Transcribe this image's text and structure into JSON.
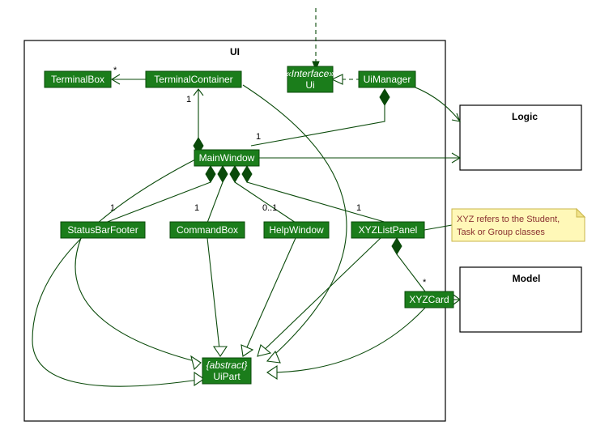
{
  "packages": {
    "ui": {
      "label": "UI"
    },
    "logic": {
      "label": "Logic"
    },
    "model": {
      "label": "Model"
    }
  },
  "nodes": {
    "terminalBox": "TerminalBox",
    "terminalContainer": "TerminalContainer",
    "uiInterface": {
      "stereotype": "«Interface»",
      "name": "Ui"
    },
    "uiManager": "UiManager",
    "mainWindow": "MainWindow",
    "statusBarFooter": "StatusBarFooter",
    "commandBox": "CommandBox",
    "helpWindow": "HelpWindow",
    "xyzListPanel": "XYZListPanel",
    "xyzCard": "XYZCard",
    "uiPart": {
      "stereotype": "{abstract}",
      "name": "UiPart"
    }
  },
  "multiplicities": {
    "terminalBox_star": "*",
    "terminalContainer_one": "1",
    "mainWindow_one": "1",
    "statusBarFooter_one": "1",
    "commandBox_one": "1",
    "helpWindow_opt": "0..1",
    "xyzListPanel_one": "1",
    "xyzCard_star": "*"
  },
  "note": {
    "line1": "XYZ refers to the Student,",
    "line2": "Task or Group classes"
  },
  "chart_data": {
    "type": "uml_class_diagram",
    "packages": [
      "UI",
      "Logic",
      "Model"
    ],
    "classes": [
      {
        "name": "TerminalBox",
        "package": "UI"
      },
      {
        "name": "TerminalContainer",
        "package": "UI"
      },
      {
        "name": "Ui",
        "package": "UI",
        "stereotype": "interface"
      },
      {
        "name": "UiManager",
        "package": "UI"
      },
      {
        "name": "MainWindow",
        "package": "UI"
      },
      {
        "name": "StatusBarFooter",
        "package": "UI"
      },
      {
        "name": "CommandBox",
        "package": "UI"
      },
      {
        "name": "HelpWindow",
        "package": "UI"
      },
      {
        "name": "XYZListPanel",
        "package": "UI"
      },
      {
        "name": "XYZCard",
        "package": "UI"
      },
      {
        "name": "UiPart",
        "package": "UI",
        "stereotype": "abstract"
      }
    ],
    "relationships": [
      {
        "from": "TerminalContainer",
        "to": "TerminalBox",
        "type": "association",
        "to_mult": "*"
      },
      {
        "from": "MainWindow",
        "to": "TerminalContainer",
        "type": "composition",
        "to_mult": "1"
      },
      {
        "from": "UiManager",
        "to": "Ui",
        "type": "realization"
      },
      {
        "from": "(external)",
        "to": "Ui",
        "type": "dependency"
      },
      {
        "from": "UiManager",
        "to": "MainWindow",
        "type": "composition",
        "to_mult": "1"
      },
      {
        "from": "MainWindow",
        "to": "StatusBarFooter",
        "type": "composition",
        "to_mult": "1"
      },
      {
        "from": "MainWindow",
        "to": "CommandBox",
        "type": "composition",
        "to_mult": "1"
      },
      {
        "from": "MainWindow",
        "to": "HelpWindow",
        "type": "composition",
        "to_mult": "0..1"
      },
      {
        "from": "MainWindow",
        "to": "XYZListPanel",
        "type": "composition",
        "to_mult": "1"
      },
      {
        "from": "XYZListPanel",
        "to": "XYZCard",
        "type": "composition",
        "to_mult": "*"
      },
      {
        "from": "MainWindow",
        "to": "UiPart",
        "type": "generalization"
      },
      {
        "from": "StatusBarFooter",
        "to": "UiPart",
        "type": "generalization"
      },
      {
        "from": "CommandBox",
        "to": "UiPart",
        "type": "generalization"
      },
      {
        "from": "HelpWindow",
        "to": "UiPart",
        "type": "generalization"
      },
      {
        "from": "XYZListPanel",
        "to": "UiPart",
        "type": "generalization"
      },
      {
        "from": "XYZCard",
        "to": "UiPart",
        "type": "generalization"
      },
      {
        "from": "TerminalContainer",
        "to": "UiPart",
        "type": "generalization"
      },
      {
        "from": "MainWindow",
        "to": "Logic",
        "type": "association"
      },
      {
        "from": "UiManager",
        "to": "Logic",
        "type": "association"
      },
      {
        "from": "XYZCard",
        "to": "Model",
        "type": "association"
      }
    ],
    "notes": [
      {
        "text": "XYZ refers to the Student, Task or Group classes",
        "attached_to": "XYZListPanel"
      }
    ]
  }
}
